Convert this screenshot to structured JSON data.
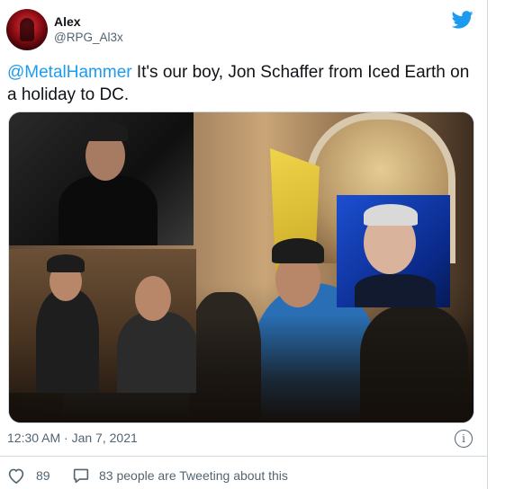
{
  "author": {
    "name": "Alex",
    "handle": "@RPG_Al3x"
  },
  "tweet": {
    "mention": "@MetalHammer",
    "body": " It's our boy, Jon Schaffer from Iced Earth on a holiday to DC."
  },
  "meta": {
    "timestamp": "12:30 AM · Jan 7, 2021"
  },
  "actions": {
    "like_count": "89",
    "conversation_text": "83 people are Tweeting about this"
  },
  "colors": {
    "accent": "#1d9bf0",
    "secondary_text": "#536471",
    "border": "#cfd9de"
  },
  "icons": {
    "brand": "twitter-bird-icon",
    "info": "info-icon",
    "like": "heart-icon",
    "reply": "speech-bubble-icon"
  }
}
